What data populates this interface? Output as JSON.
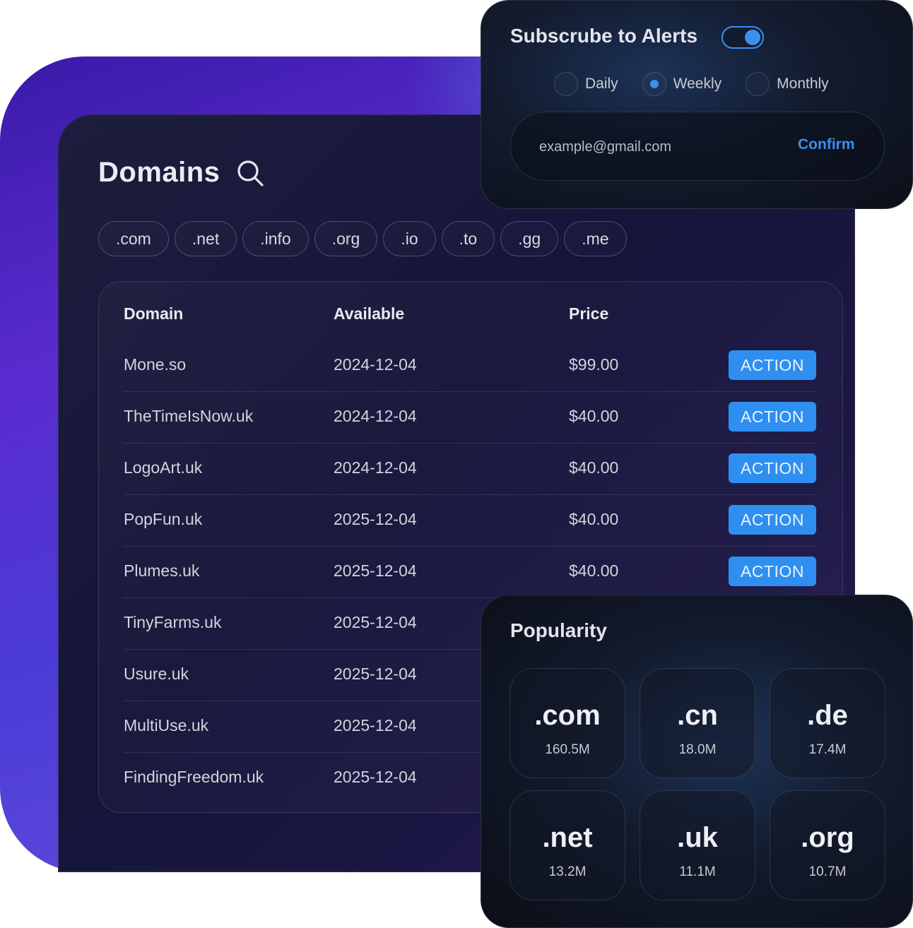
{
  "domains_panel": {
    "title": "Domains",
    "search_icon": "search-icon",
    "tld_filters": [
      ".com",
      ".net",
      ".info",
      ".org",
      ".io",
      ".to",
      ".gg",
      ".me"
    ],
    "table": {
      "columns": [
        "Domain",
        "Available",
        "Price"
      ],
      "action_label": "ACTION",
      "rows": [
        {
          "domain": "Mone.so",
          "available": "2024-12-04",
          "price": "$99.00"
        },
        {
          "domain": "TheTimeIsNow.uk",
          "available": "2024-12-04",
          "price": "$40.00"
        },
        {
          "domain": "LogoArt.uk",
          "available": "2024-12-04",
          "price": "$40.00"
        },
        {
          "domain": "PopFun.uk",
          "available": "2025-12-04",
          "price": "$40.00"
        },
        {
          "domain": "Plumes.uk",
          "available": "2025-12-04",
          "price": "$40.00"
        },
        {
          "domain": "TinyFarms.uk",
          "available": "2025-12-04",
          "price": ""
        },
        {
          "domain": "Usure.uk",
          "available": "2025-12-04",
          "price": ""
        },
        {
          "domain": "MultiUse.uk",
          "available": "2025-12-04",
          "price": ""
        },
        {
          "domain": "FindingFreedom.uk",
          "available": "2025-12-04",
          "price": ""
        }
      ]
    }
  },
  "alerts": {
    "title": "Subscrube to Alerts",
    "toggle_on": true,
    "frequency_options": [
      "Daily",
      "Weekly",
      "Monthly"
    ],
    "selected_frequency": "Weekly",
    "email_placeholder": "example@gmail.com",
    "confirm_label": "Confirm"
  },
  "popularity": {
    "title": "Popularity",
    "tlds": [
      {
        "ext": ".com",
        "count": "160.5M"
      },
      {
        "ext": ".cn",
        "count": "18.0M"
      },
      {
        "ext": ".de",
        "count": "17.4M"
      },
      {
        "ext": ".net",
        "count": "13.2M"
      },
      {
        "ext": ".uk",
        "count": "11.1M"
      },
      {
        "ext": ".org",
        "count": "10.7M"
      }
    ]
  },
  "colors": {
    "accent": "#2f8ff0",
    "gradient_purple": "#5a2cd0",
    "panel_dark": "#15153a"
  }
}
